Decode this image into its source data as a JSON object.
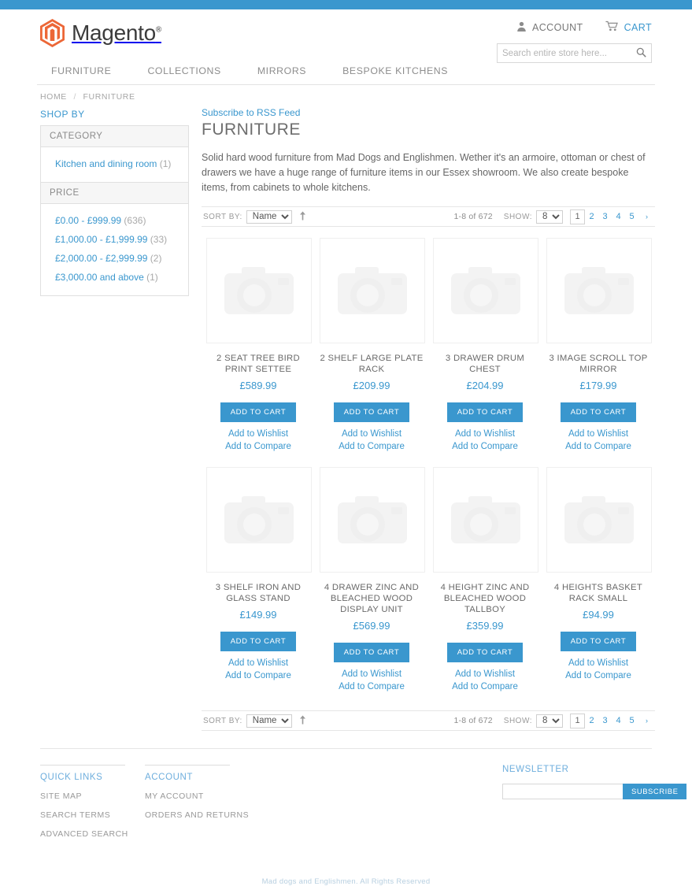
{
  "brand": {
    "name": "Magento",
    "trademark": "®",
    "accent": "#3a97ce",
    "logo_orange": "#ec6737"
  },
  "topbar": {
    "color": "#3a97ce"
  },
  "header": {
    "account_label": "ACCOUNT",
    "cart_label": "CART",
    "search": {
      "placeholder": "Search entire store here...",
      "value": ""
    }
  },
  "nav": {
    "items": [
      {
        "label": "FURNITURE"
      },
      {
        "label": "COLLECTIONS"
      },
      {
        "label": "MIRRORS"
      },
      {
        "label": "BESPOKE KITCHENS"
      }
    ]
  },
  "breadcrumb": {
    "home": "HOME",
    "separator": "/",
    "current": "FURNITURE"
  },
  "sidebar": {
    "shop_by": "SHOP BY",
    "groups": [
      {
        "title": "CATEGORY",
        "options": [
          {
            "label": "Kitchen and dining room",
            "count": "(1)"
          }
        ]
      },
      {
        "title": "PRICE",
        "options": [
          {
            "label": "£0.00 - £999.99",
            "count": "(636)"
          },
          {
            "label": "£1,000.00 - £1,999.99",
            "count": "(33)"
          },
          {
            "label": "£2,000.00 - £2,999.99",
            "count": "(2)"
          },
          {
            "label": "£3,000.00 and above",
            "count": "(1)"
          }
        ]
      }
    ]
  },
  "main": {
    "rss_label": "Subscribe to RSS Feed",
    "title": "FURNITURE",
    "description": "Solid hard wood furniture from Mad Dogs and Englishmen. Wether it's an armoire, ottoman or chest of drawers we have a huge range of furniture items in our Essex showroom. We also create bespoke items, from cabinets to whole kitchens."
  },
  "toolbar": {
    "sort_label": "SORT BY:",
    "sort_value": "Name",
    "sort_direction_icon": "arrow-up-icon",
    "count_text": "1-8 of 672",
    "show_label": "SHOW:",
    "show_value": "8",
    "pages": [
      "1",
      "2",
      "3",
      "4",
      "5"
    ],
    "current_page": "1",
    "next_label": "›"
  },
  "products": [
    {
      "name": "2 SEAT TREE BIRD PRINT SETTEE",
      "price": "£589.99",
      "cart": "ADD TO CART",
      "wishlist": "Add to Wishlist",
      "compare": "Add to Compare"
    },
    {
      "name": "2 SHELF LARGE PLATE RACK",
      "price": "£209.99",
      "cart": "ADD TO CART",
      "wishlist": "Add to Wishlist",
      "compare": "Add to Compare"
    },
    {
      "name": "3 DRAWER DRUM CHEST",
      "price": "£204.99",
      "cart": "ADD TO CART",
      "wishlist": "Add to Wishlist",
      "compare": "Add to Compare"
    },
    {
      "name": "3 IMAGE SCROLL TOP MIRROR",
      "price": "£179.99",
      "cart": "ADD TO CART",
      "wishlist": "Add to Wishlist",
      "compare": "Add to Compare"
    },
    {
      "name": "3 SHELF IRON AND GLASS STAND",
      "price": "£149.99",
      "cart": "ADD TO CART",
      "wishlist": "Add to Wishlist",
      "compare": "Add to Compare"
    },
    {
      "name": "4 DRAWER ZINC AND BLEACHED WOOD DISPLAY UNIT",
      "price": "£569.99",
      "cart": "ADD TO CART",
      "wishlist": "Add to Wishlist",
      "compare": "Add to Compare"
    },
    {
      "name": "4 HEIGHT ZINC AND BLEACHED WOOD TALLBOY",
      "price": "£359.99",
      "cart": "ADD TO CART",
      "wishlist": "Add to Wishlist",
      "compare": "Add to Compare"
    },
    {
      "name": "4 HEIGHTS BASKET RACK SMALL",
      "price": "£94.99",
      "cart": "ADD TO CART",
      "wishlist": "Add to Wishlist",
      "compare": "Add to Compare"
    }
  ],
  "footer": {
    "columns": [
      {
        "title": "QUICK LINKS",
        "links": [
          "SITE MAP",
          "SEARCH TERMS",
          "ADVANCED SEARCH"
        ]
      },
      {
        "title": "ACCOUNT",
        "links": [
          "MY ACCOUNT",
          "ORDERS AND RETURNS"
        ]
      }
    ],
    "newsletter": {
      "title": "NEWSLETTER",
      "value": "",
      "button": "SUBSCRIBE"
    },
    "copyright": "Mad dogs and Englishmen. All Rights Reserved"
  }
}
